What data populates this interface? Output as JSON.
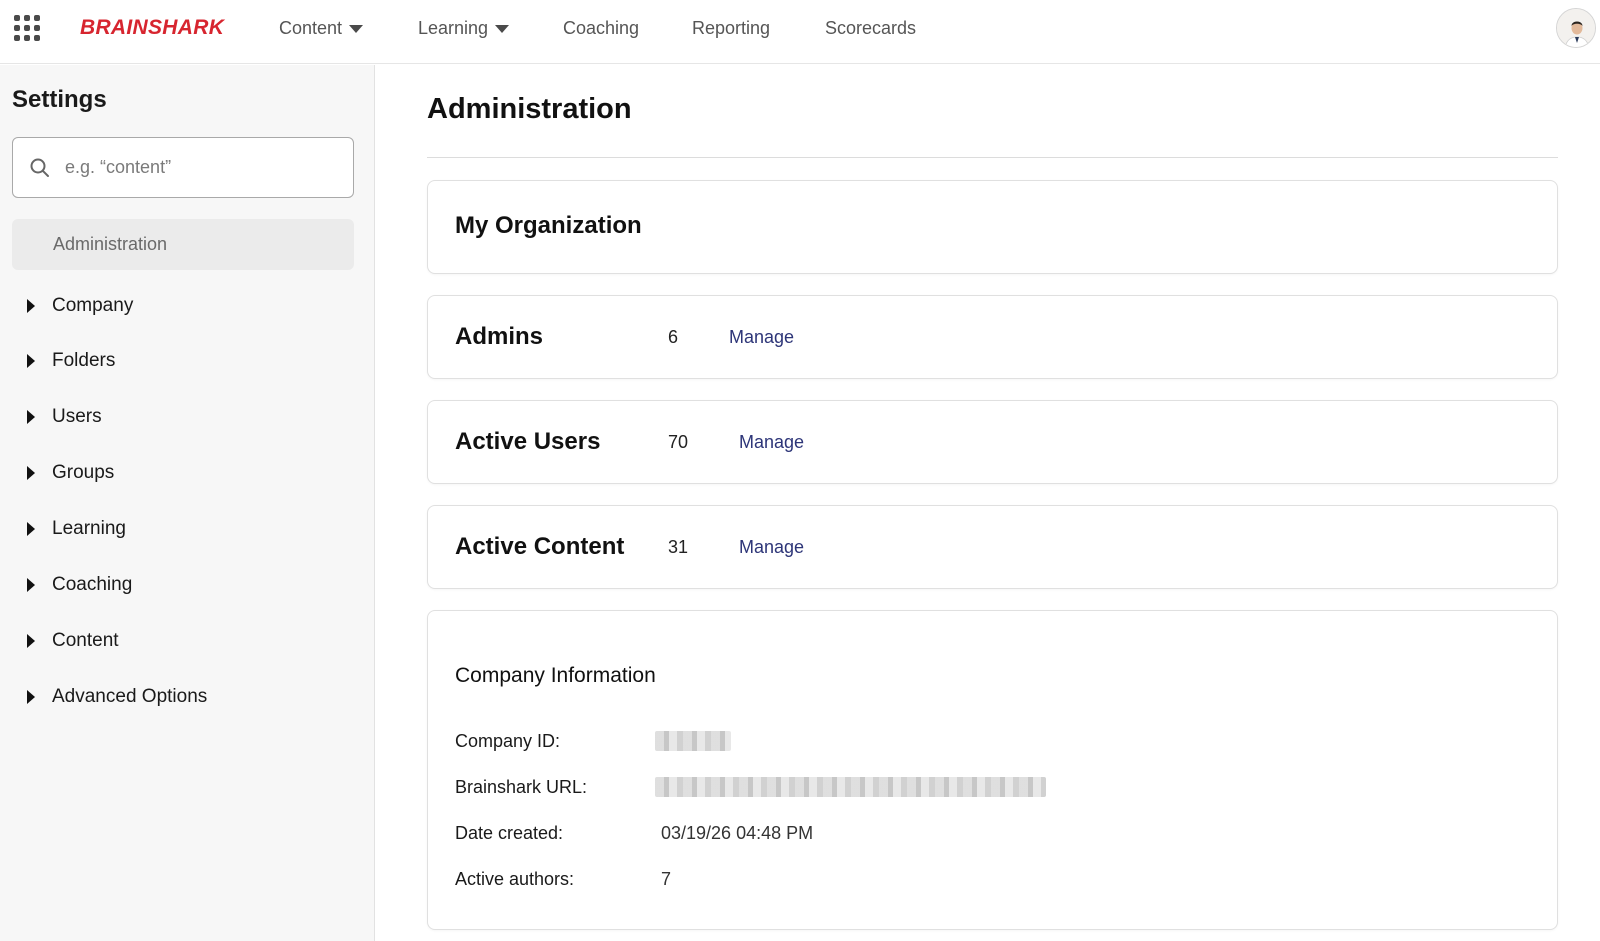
{
  "header": {
    "logo_text": "BRAINSHARK",
    "brand_color": "#d7252f",
    "nav": [
      {
        "label": "Content",
        "has_dropdown": true
      },
      {
        "label": "Learning",
        "has_dropdown": true
      },
      {
        "label": "Coaching",
        "has_dropdown": false
      },
      {
        "label": "Reporting",
        "has_dropdown": false
      },
      {
        "label": "Scorecards",
        "has_dropdown": false
      }
    ],
    "icons": {
      "apps": "grid-icon",
      "dropdown": "caret-down-icon",
      "profile": "avatar"
    }
  },
  "sidebar": {
    "title": "Settings",
    "search_placeholder": "e.g. “content”",
    "search_icon": "search-icon",
    "active_item": "Administration",
    "items": [
      {
        "label": "Company"
      },
      {
        "label": "Folders"
      },
      {
        "label": "Users"
      },
      {
        "label": "Groups"
      },
      {
        "label": "Learning"
      },
      {
        "label": "Coaching"
      },
      {
        "label": "Content"
      },
      {
        "label": "Advanced Options"
      }
    ]
  },
  "main": {
    "title": "Administration",
    "my_org": {
      "title": "My Organization"
    },
    "stats": [
      {
        "title": "Admins",
        "count": "6",
        "link": "Manage"
      },
      {
        "title": "Active Users",
        "count": "70",
        "link": "Manage"
      },
      {
        "title": "Active Content",
        "count": "31",
        "link": "Manage"
      }
    ],
    "company_info": {
      "title": "Company Information",
      "rows": [
        {
          "label": "Company ID:",
          "value": "",
          "redacted": true
        },
        {
          "label": "Brainshark URL:",
          "value": "",
          "redacted": true
        },
        {
          "label": "Date created:",
          "value": "03/19/26 04:48 PM",
          "redacted": false
        },
        {
          "label": "Active authors:",
          "value": "7",
          "redacted": false
        }
      ]
    },
    "link_color": "#2d3578"
  }
}
